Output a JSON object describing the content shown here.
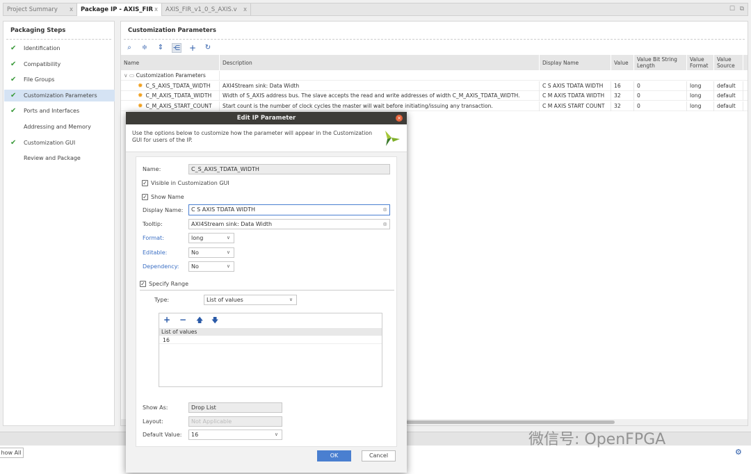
{
  "tabs": [
    {
      "label": "Project Summary",
      "active": false
    },
    {
      "label": "Package IP - AXIS_FIR",
      "active": true
    },
    {
      "label": "AXIS_FIR_v1_0_S_AXIS.v",
      "active": false
    }
  ],
  "tab_close": "x",
  "steps": {
    "title": "Packaging Steps",
    "items": [
      {
        "label": "Identification",
        "done": true
      },
      {
        "label": "Compatibility",
        "done": true
      },
      {
        "label": "File Groups",
        "done": true
      },
      {
        "label": "Customization Parameters",
        "done": true,
        "selected": true
      },
      {
        "label": "Ports and Interfaces",
        "done": true
      },
      {
        "label": "Addressing and Memory",
        "done": false
      },
      {
        "label": "Customization GUI",
        "done": true
      },
      {
        "label": "Review and Package",
        "done": false
      }
    ]
  },
  "check_glyph": "✔",
  "params": {
    "title": "Customization Parameters",
    "columns": [
      "Name",
      "Description",
      "Display Name",
      "Value",
      "Value Bit String Length",
      "Value Format",
      "Value Source"
    ],
    "group": "Customization Parameters",
    "rows": [
      {
        "name": "C_S_AXIS_TDATA_WIDTH",
        "description": "AXI4Stream sink: Data Width",
        "display": "C S AXIS TDATA WIDTH",
        "value": "16",
        "bitlen": "0",
        "format": "long",
        "source": "default"
      },
      {
        "name": "C_M_AXIS_TDATA_WIDTH",
        "description": "Width of S_AXIS address bus. The slave accepts the read and write addresses of width C_M_AXIS_TDATA_WIDTH.",
        "display": "C M AXIS TDATA WIDTH",
        "value": "32",
        "bitlen": "0",
        "format": "long",
        "source": "default"
      },
      {
        "name": "C_M_AXIS_START_COUNT",
        "description": "Start count is the number of clock cycles the master will wait before initiating/issuing any transaction.",
        "display": "C M AXIS START COUNT",
        "value": "32",
        "bitlen": "0",
        "format": "long",
        "source": "default"
      }
    ]
  },
  "bottom": {
    "show_all": "how All"
  },
  "dialog": {
    "title": "Edit IP Parameter",
    "intro": "Use the options below to customize how the parameter will appear in the Customization GUI for users of the IP.",
    "name_label": "Name:",
    "name_value": "C_S_AXIS_TDATA_WIDTH",
    "visible_label": "Visible in Customization GUI",
    "visible_checked": true,
    "show_name_label": "Show Name",
    "show_name_checked": true,
    "display_name_label": "Display Name:",
    "display_name_value": "C S AXIS TDATA WIDTH",
    "tooltip_label": "Tooltip:",
    "tooltip_value": "AXI4Stream sink: Data Width",
    "format_label": "Format:",
    "format_value": "long",
    "editable_label": "Editable:",
    "editable_value": "No",
    "dependency_label": "Dependency:",
    "dependency_value": "No",
    "specify_range_label": "Specify Range",
    "specify_range_checked": true,
    "type_label": "Type:",
    "type_value": "List of values",
    "list_header": "List of values",
    "list_values": [
      "16"
    ],
    "show_as_label": "Show As:",
    "show_as_value": "Drop List",
    "layout_label": "Layout:",
    "layout_value": "Not Applicable",
    "default_label": "Default Value:",
    "default_value": "16",
    "ok": "OK",
    "cancel": "Cancel"
  },
  "watermark": "微信号: OpenFPGA",
  "accent": "#4a7fd0"
}
